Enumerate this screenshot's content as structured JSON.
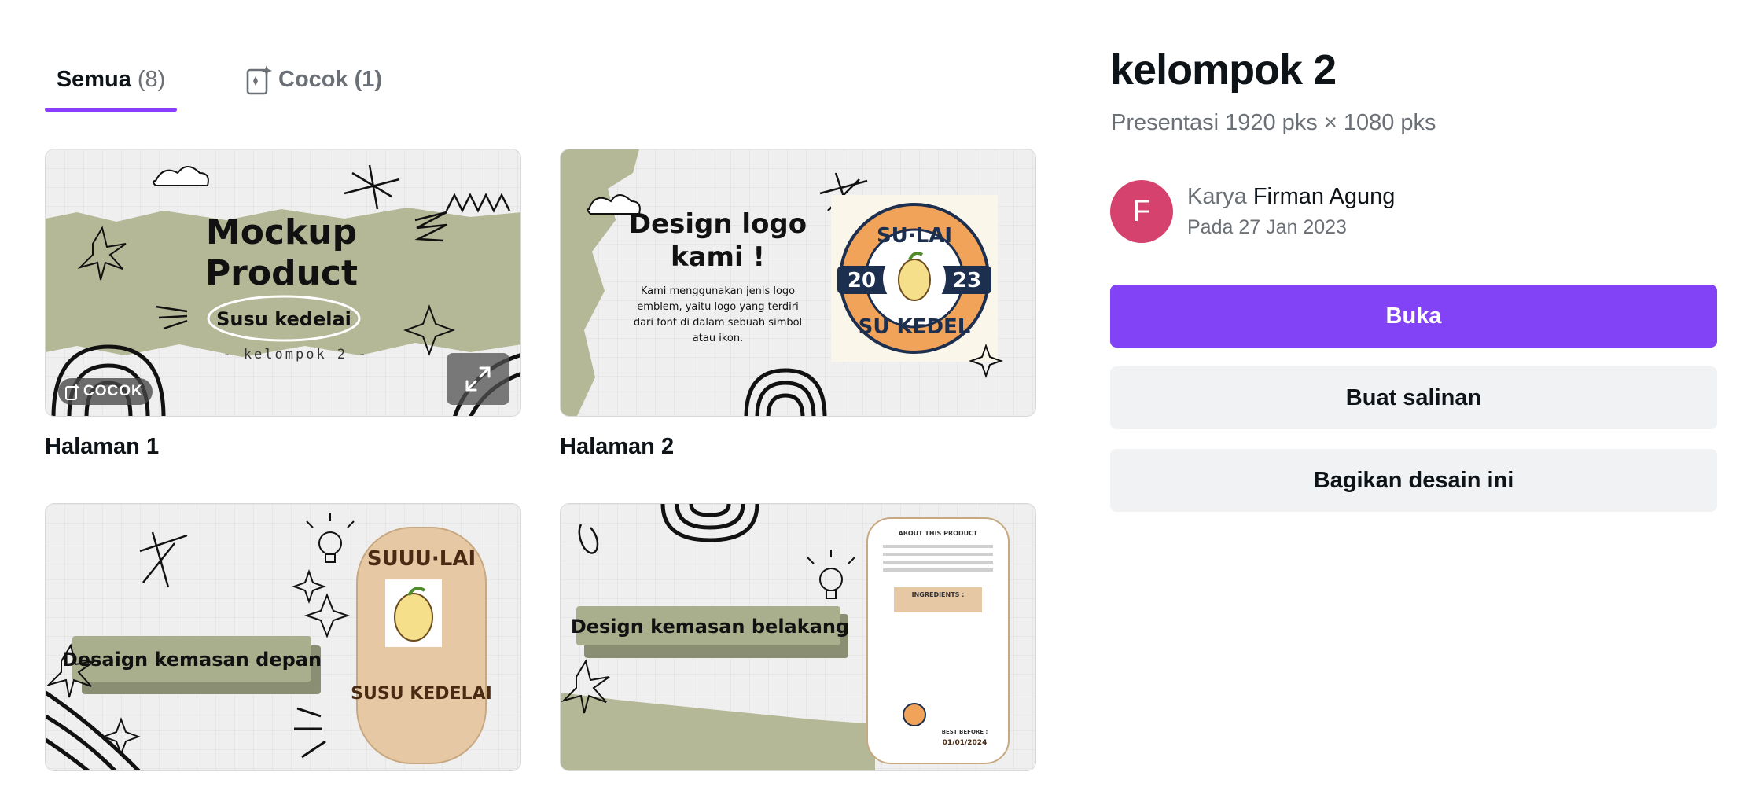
{
  "tabs": {
    "all_label": "Semua",
    "all_count": "(8)",
    "match_label": "Cocok",
    "match_count": "(1)"
  },
  "pages": [
    {
      "label": "Halaman 1",
      "badge": "COCOK",
      "heading_line1": "Mockup",
      "heading_line2": "Product",
      "subheading": "Susu kedelai",
      "caption": "- kelompok 2 -"
    },
    {
      "label": "Halaman 2",
      "heading_line1": "Design logo",
      "heading_line2": "kami !",
      "body_lines": [
        "Kami menggunakan jenis logo",
        "emblem, yaitu logo yang terdiri",
        "dari font di dalam sebuah simbol",
        "atau ikon."
      ],
      "logo_top": "SU·LAI",
      "logo_bottom": "SU KEDEL",
      "logo_left": "20",
      "logo_right": "23"
    },
    {
      "heading": "Desaign kemasan depan",
      "pack_top": "SUUU·LAI",
      "pack_bottom": "SUSU KEDELAI"
    },
    {
      "heading": "Design kemasan belakang",
      "pack_title": "ABOUT THIS PRODUCT",
      "pack_ingredients": "INGREDIENTS :",
      "pack_best_before": "BEST BEFORE :",
      "pack_date": "01/01/2024"
    }
  ],
  "design": {
    "title": "kelompok 2",
    "subtitle": "Presentasi 1920 pks × 1080 pks",
    "author_prefix": "Karya",
    "author_name": "Firman Agung",
    "avatar_initial": "F",
    "date": "Pada 27 Jan 2023"
  },
  "actions": {
    "open": "Buka",
    "copy": "Buat salinan",
    "share": "Bagikan desain ini"
  },
  "colors": {
    "accent": "#8b3dff",
    "primary_button": "#8143f5",
    "avatar": "#d5426e",
    "olive": "#b5b896"
  }
}
